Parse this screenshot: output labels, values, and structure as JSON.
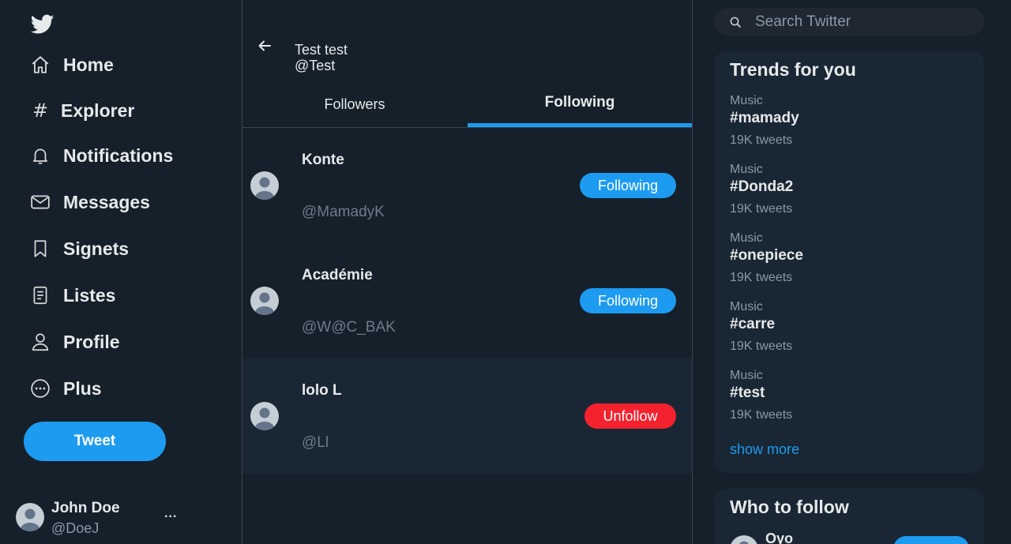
{
  "sidebar": {
    "items": [
      {
        "label": "Home",
        "icon": "home-icon"
      },
      {
        "label": "Explorer",
        "icon": "hash-icon",
        "glyph": "#"
      },
      {
        "label": "Notifications",
        "icon": "bell-icon"
      },
      {
        "label": "Messages",
        "icon": "envelope-icon"
      },
      {
        "label": "Signets",
        "icon": "bookmark-icon"
      },
      {
        "label": "Listes",
        "icon": "list-icon"
      },
      {
        "label": "Profile",
        "icon": "person-icon"
      },
      {
        "label": "Plus",
        "icon": "more-circle-icon"
      }
    ],
    "tweet_label": "Tweet",
    "account": {
      "name": "John Doe",
      "handle": "@DoeJ",
      "more": "..."
    }
  },
  "profile_header": {
    "name": "Test test",
    "handle": "@Test"
  },
  "tabs": [
    {
      "label": "Followers",
      "active": false
    },
    {
      "label": "Following",
      "active": true
    }
  ],
  "users": [
    {
      "name": "Konte",
      "handle": "@MamadyK",
      "button": "Following"
    },
    {
      "name": "Académie",
      "handle": "@W@C_BAK",
      "button": "Following"
    },
    {
      "name": "lolo L",
      "handle": "@Ll",
      "button": "Unfollow"
    }
  ],
  "search": {
    "placeholder": "Search Twitter"
  },
  "trends": {
    "title": "Trends for you",
    "items": [
      {
        "category": "Music",
        "tag": "#mamady",
        "count": "19K tweets"
      },
      {
        "category": "Music",
        "tag": "#Donda2",
        "count": "19K tweets"
      },
      {
        "category": "Music",
        "tag": "#onepiece",
        "count": "19K tweets"
      },
      {
        "category": "Music",
        "tag": "#carre",
        "count": "19K tweets"
      },
      {
        "category": "Music",
        "tag": "#test",
        "count": "19K tweets"
      }
    ],
    "show_more": "show more"
  },
  "who_to_follow": {
    "title": "Who to follow",
    "suggestions": [
      {
        "name": "Oyo"
      }
    ]
  },
  "colors": {
    "background": "#15202b",
    "panel": "#192734",
    "accent": "#1d9bf0",
    "danger": "#f4212e",
    "border": "#38444d",
    "muted": "#8b98a5"
  }
}
